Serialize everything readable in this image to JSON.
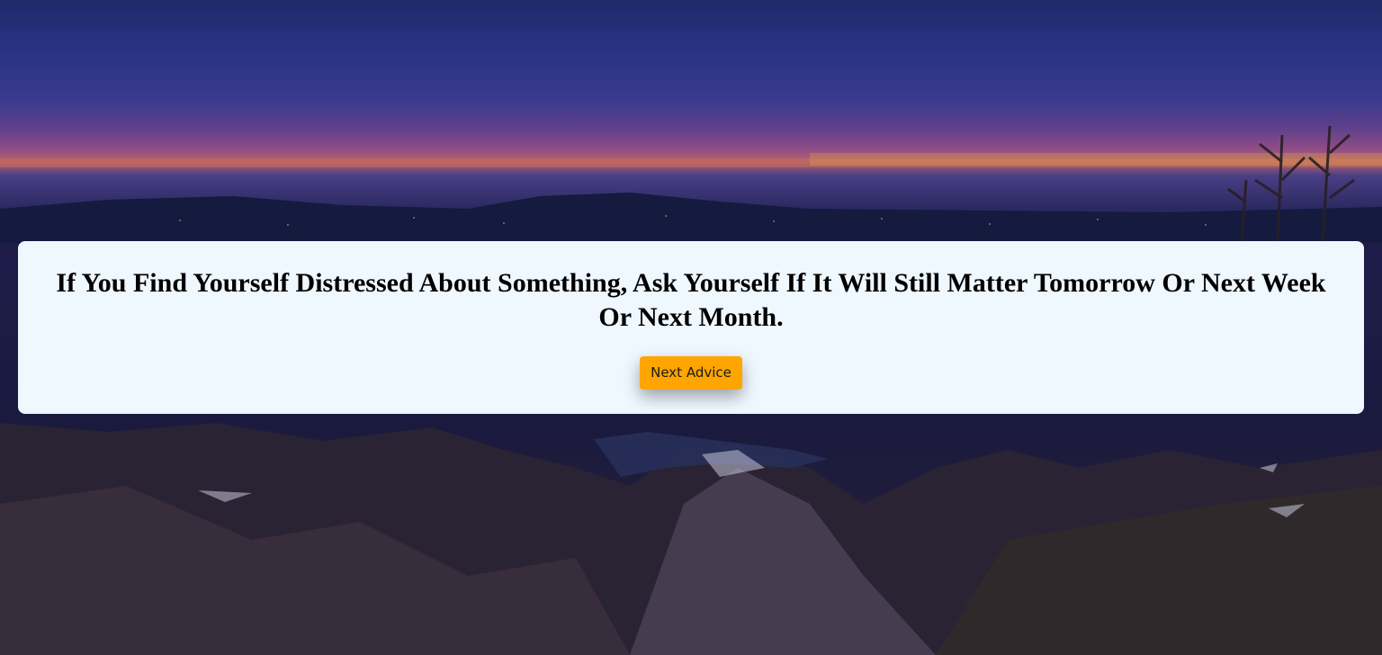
{
  "advice": {
    "text": "If You Find Yourself Distressed About Something, Ask Yourself If It Will Still Matter Tomorrow Or Next Week Or Next Month."
  },
  "actions": {
    "next_label": "Next Advice"
  },
  "colors": {
    "card_background": "#eff7ff",
    "button_background": "#ffa500",
    "text": "#000000"
  }
}
